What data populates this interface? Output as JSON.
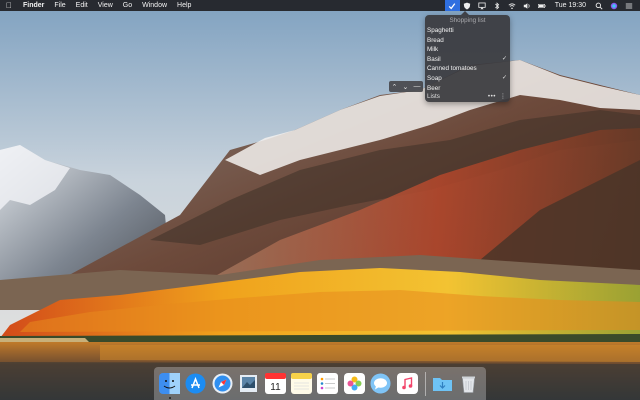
{
  "menubar": {
    "app_name": "Finder",
    "menus": [
      "File",
      "Edit",
      "View",
      "Go",
      "Window",
      "Help"
    ],
    "clock": "Tue 19:30"
  },
  "shopping_list": {
    "title": "Shopping list",
    "items": [
      {
        "label": "Spaghetti",
        "checked": false
      },
      {
        "label": "Bread",
        "checked": false
      },
      {
        "label": "Milk",
        "checked": false
      },
      {
        "label": "Basil",
        "checked": true
      },
      {
        "label": "Canned tomatoes",
        "checked": false
      },
      {
        "label": "Soap",
        "checked": true
      },
      {
        "label": "Beer",
        "checked": false
      }
    ],
    "footer_label": "Lists",
    "footer_more": "•••",
    "check_glyph": "✓"
  },
  "mini_toolbar": {
    "up": "⌃",
    "down": "⌄",
    "minus": "—"
  },
  "dock": {
    "apps": [
      "finder",
      "app-store",
      "safari",
      "preview",
      "calendar",
      "notes",
      "reminders",
      "photos",
      "messages",
      "itunes"
    ],
    "calendar_day": "11",
    "trailing": [
      "downloads-folder",
      "trash"
    ]
  },
  "colors": {
    "menubar_bg": "#202024",
    "accent": "#2f6fe0",
    "popover_bg": "#3a3a3e"
  }
}
